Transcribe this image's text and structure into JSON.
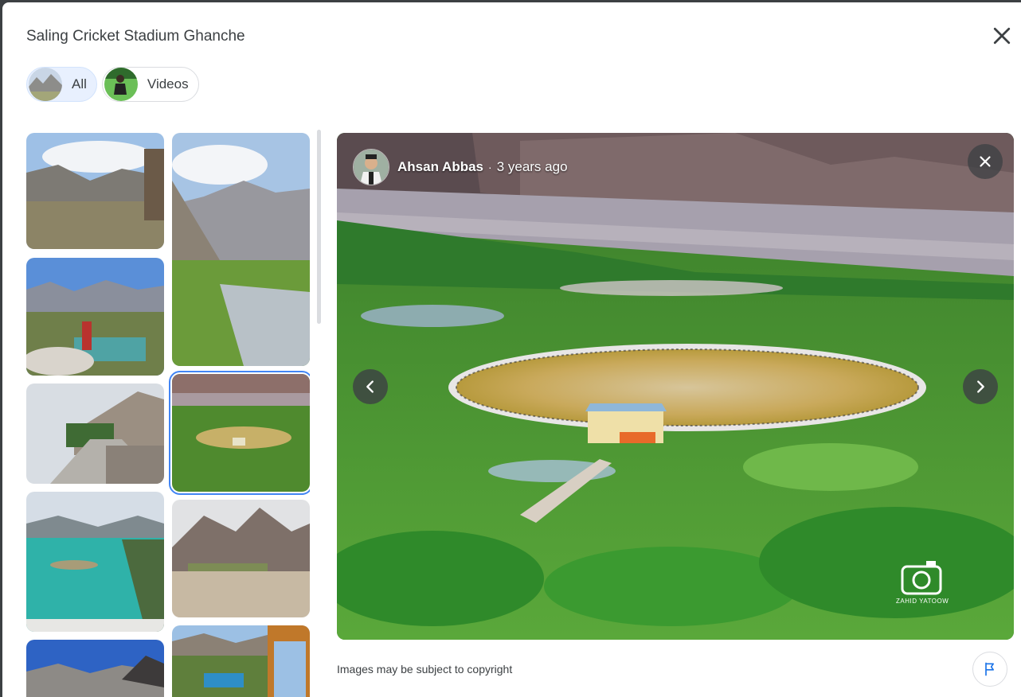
{
  "dialog": {
    "title": "Saling Cricket Stadium Ghanche"
  },
  "filters": [
    {
      "label": "All",
      "selected": true
    },
    {
      "label": "Videos",
      "selected": false
    }
  ],
  "viewer": {
    "author_name": "Ahsan Abbas",
    "separator": "·",
    "posted_time": "3 years ago",
    "watermark_text": "ZAHID YATOOW"
  },
  "footer": {
    "copyright_notice": "Images may be subject to copyright"
  },
  "icons": {
    "close": "close-icon",
    "prev": "chevron-left-icon",
    "next": "chevron-right-icon",
    "report": "flag-icon",
    "watermark": "camera-icon"
  },
  "colors": {
    "accent": "#1a73e8",
    "selected_outline": "#4285f4",
    "chip_selected_bg": "#e8f0fe"
  }
}
